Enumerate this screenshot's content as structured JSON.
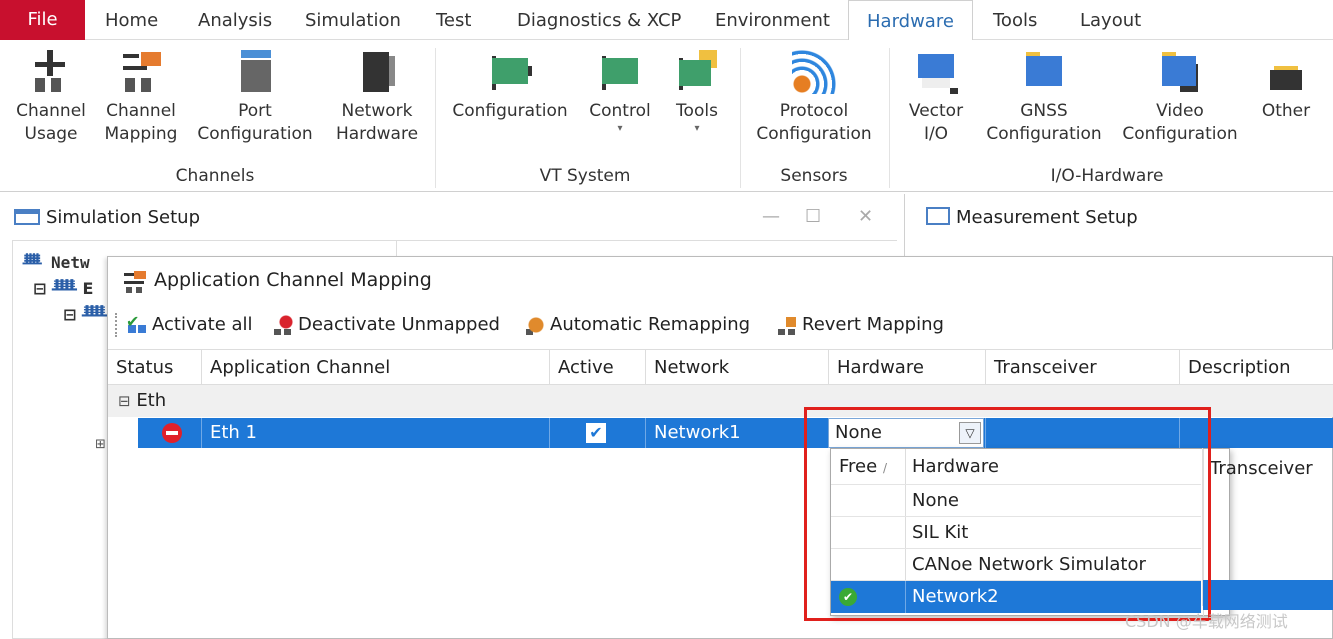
{
  "menu": {
    "file": "File",
    "items": [
      "Home",
      "Analysis",
      "Simulation",
      "Test",
      "Diagnostics & XCP",
      "Environment",
      "Hardware",
      "Tools",
      "Layout"
    ],
    "active": "Hardware"
  },
  "ribbon": {
    "channels": {
      "group": "Channels",
      "channel_usage": "Channel\nUsage",
      "channel_mapping": "Channel\nMapping",
      "port_configuration": "Port\nConfiguration",
      "network_hardware": "Network\nHardware"
    },
    "vt_system": {
      "group": "VT System",
      "configuration": "Configuration",
      "control": "Control",
      "tools": "Tools"
    },
    "sensors": {
      "group": "Sensors",
      "protocol_configuration": "Protocol\nConfiguration"
    },
    "io_hardware": {
      "group": "I/O-Hardware",
      "vector_io": "Vector\nI/O",
      "gnss_configuration": "GNSS\nConfiguration",
      "video_configuration": "Video\nConfiguration",
      "other": "Other"
    }
  },
  "panels": {
    "simulation_setup": "Simulation Setup",
    "measurement_setup": "Measurement Setup",
    "tree_root": "Netw",
    "tree_child": "E"
  },
  "dialog": {
    "title": "Application Channel Mapping",
    "toolbar": {
      "activate_all": "Activate all",
      "deactivate_unmapped": "Deactivate Unmapped",
      "automatic_remapping": "Automatic Remapping",
      "revert_mapping": "Revert Mapping"
    },
    "columns": {
      "status": "Status",
      "application_channel": "Application Channel",
      "active": "Active",
      "network": "Network",
      "hardware": "Hardware",
      "transceiver": "Transceiver",
      "description": "Description"
    },
    "group_label": "Eth",
    "row": {
      "application_channel": "Eth 1",
      "active": true,
      "network": "Network1",
      "hardware": "None"
    },
    "dropdown": {
      "col_free": "Free",
      "col_hardware": "Hardware",
      "col_transceiver": "Transceiver",
      "options": [
        "None",
        "SIL Kit",
        "CANoe Network Simulator",
        "Network2"
      ],
      "selected": "Network2"
    }
  },
  "watermark": "CSDN @车载网络测试",
  "colors": {
    "file_red": "#c8102e",
    "selection_blue": "#1e78d7",
    "highlight_red": "#e0201c",
    "ok_green": "#3aa935"
  }
}
